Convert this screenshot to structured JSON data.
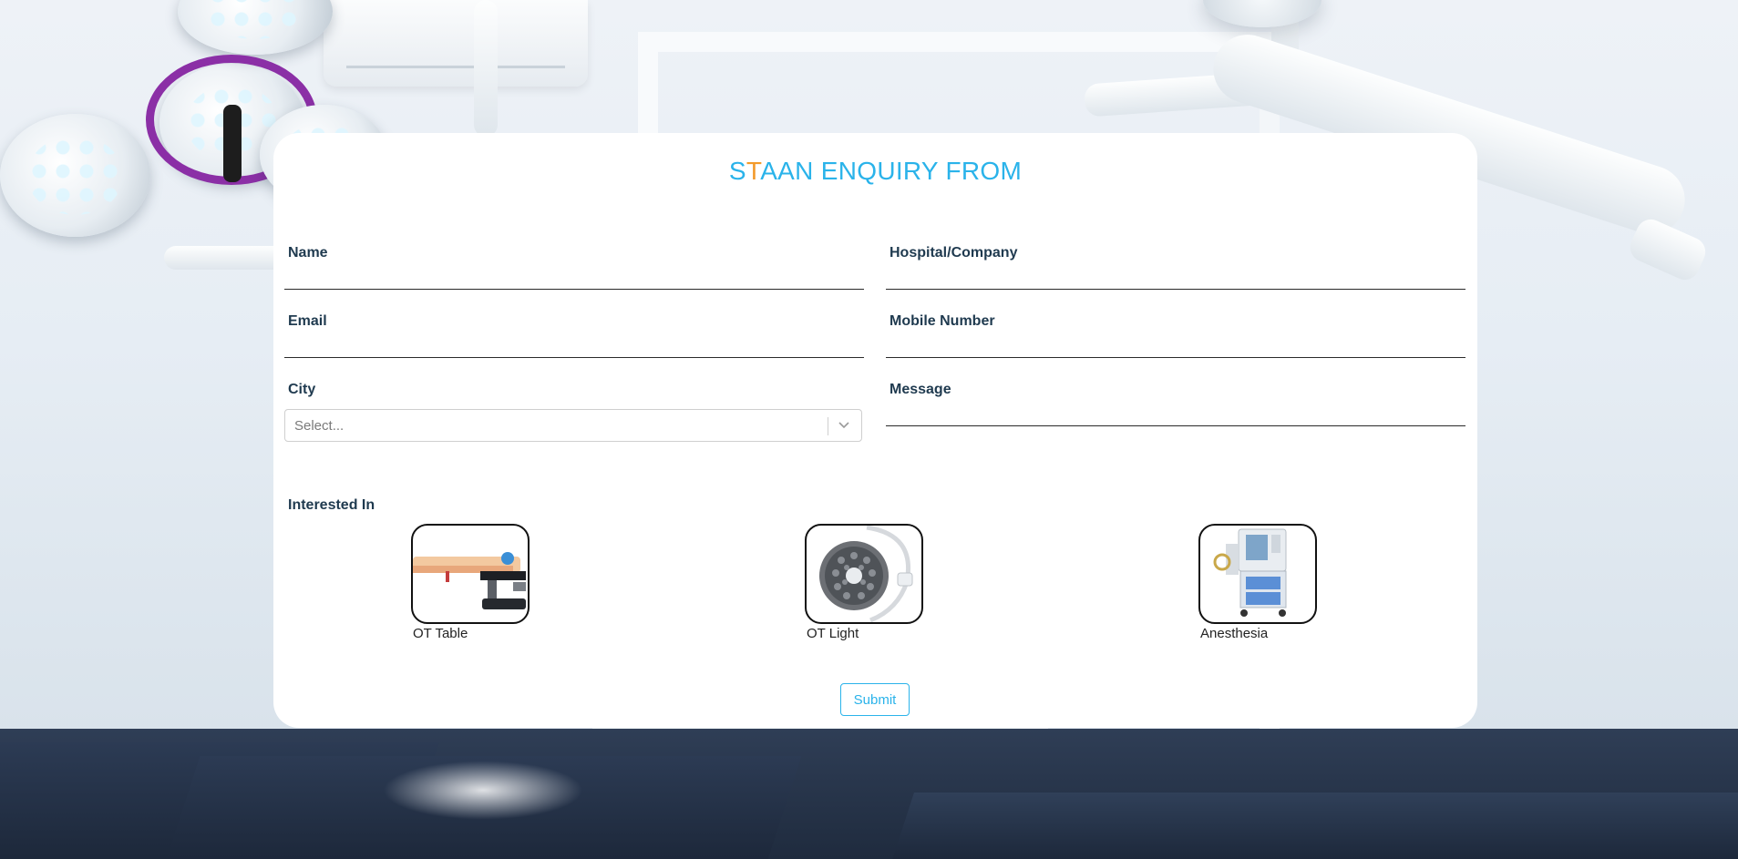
{
  "form": {
    "title_s": "S",
    "title_t": "T",
    "title_rest": "AAN ENQUIRY FROM",
    "fields": {
      "name": {
        "label": "Name",
        "value": ""
      },
      "hospital": {
        "label": "Hospital/Company",
        "value": ""
      },
      "email": {
        "label": "Email",
        "value": ""
      },
      "mobile": {
        "label": "Mobile Number",
        "value": ""
      },
      "city": {
        "label": "City",
        "placeholder": "Select..."
      },
      "message": {
        "label": "Message",
        "value": ""
      }
    },
    "interested_label": "Interested In",
    "options": [
      {
        "label": "OT Table",
        "icon": "ot-table-image"
      },
      {
        "label": "OT Light",
        "icon": "ot-light-image"
      },
      {
        "label": "Anesthesia",
        "icon": "anesthesia-machine-image"
      }
    ],
    "submit_label": "Submit"
  },
  "colors": {
    "accent": "#2ab3ea",
    "title_highlight": "#f39a2a",
    "label": "#1f3a4f"
  }
}
